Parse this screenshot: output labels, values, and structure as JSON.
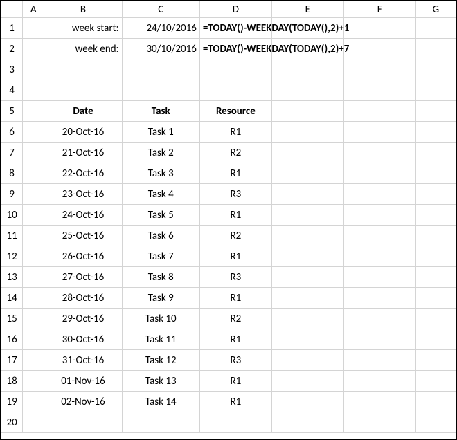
{
  "columns": [
    "A",
    "B",
    "C",
    "D",
    "E",
    "F",
    "G"
  ],
  "row_count": 20,
  "header": {
    "week_start_label": "week start:",
    "week_start_value": "24/10/2016",
    "week_start_formula": "=TODAY()-WEEKDAY(TODAY(),2)+1",
    "week_end_label": "week end:",
    "week_end_value": "30/10/2016",
    "week_end_formula": "=TODAY()-WEEKDAY(TODAY(),2)+7"
  },
  "table": {
    "col_date": "Date",
    "col_task": "Task",
    "col_resource": "Resource",
    "rows": [
      {
        "date": "20-Oct-16",
        "task": "Task 1",
        "resource": "R1"
      },
      {
        "date": "21-Oct-16",
        "task": "Task 2",
        "resource": "R2"
      },
      {
        "date": "22-Oct-16",
        "task": "Task 3",
        "resource": "R1"
      },
      {
        "date": "23-Oct-16",
        "task": "Task 4",
        "resource": "R3"
      },
      {
        "date": "24-Oct-16",
        "task": "Task 5",
        "resource": "R1"
      },
      {
        "date": "25-Oct-16",
        "task": "Task 6",
        "resource": "R2"
      },
      {
        "date": "26-Oct-16",
        "task": "Task 7",
        "resource": "R1"
      },
      {
        "date": "27-Oct-16",
        "task": "Task 8",
        "resource": "R3"
      },
      {
        "date": "28-Oct-16",
        "task": "Task 9",
        "resource": "R1"
      },
      {
        "date": "29-Oct-16",
        "task": "Task 10",
        "resource": "R2"
      },
      {
        "date": "30-Oct-16",
        "task": "Task 11",
        "resource": "R1"
      },
      {
        "date": "31-Oct-16",
        "task": "Task 12",
        "resource": "R3"
      },
      {
        "date": "01-Nov-16",
        "task": "Task 13",
        "resource": "R1"
      },
      {
        "date": "02-Nov-16",
        "task": "Task 14",
        "resource": "R1"
      }
    ]
  }
}
